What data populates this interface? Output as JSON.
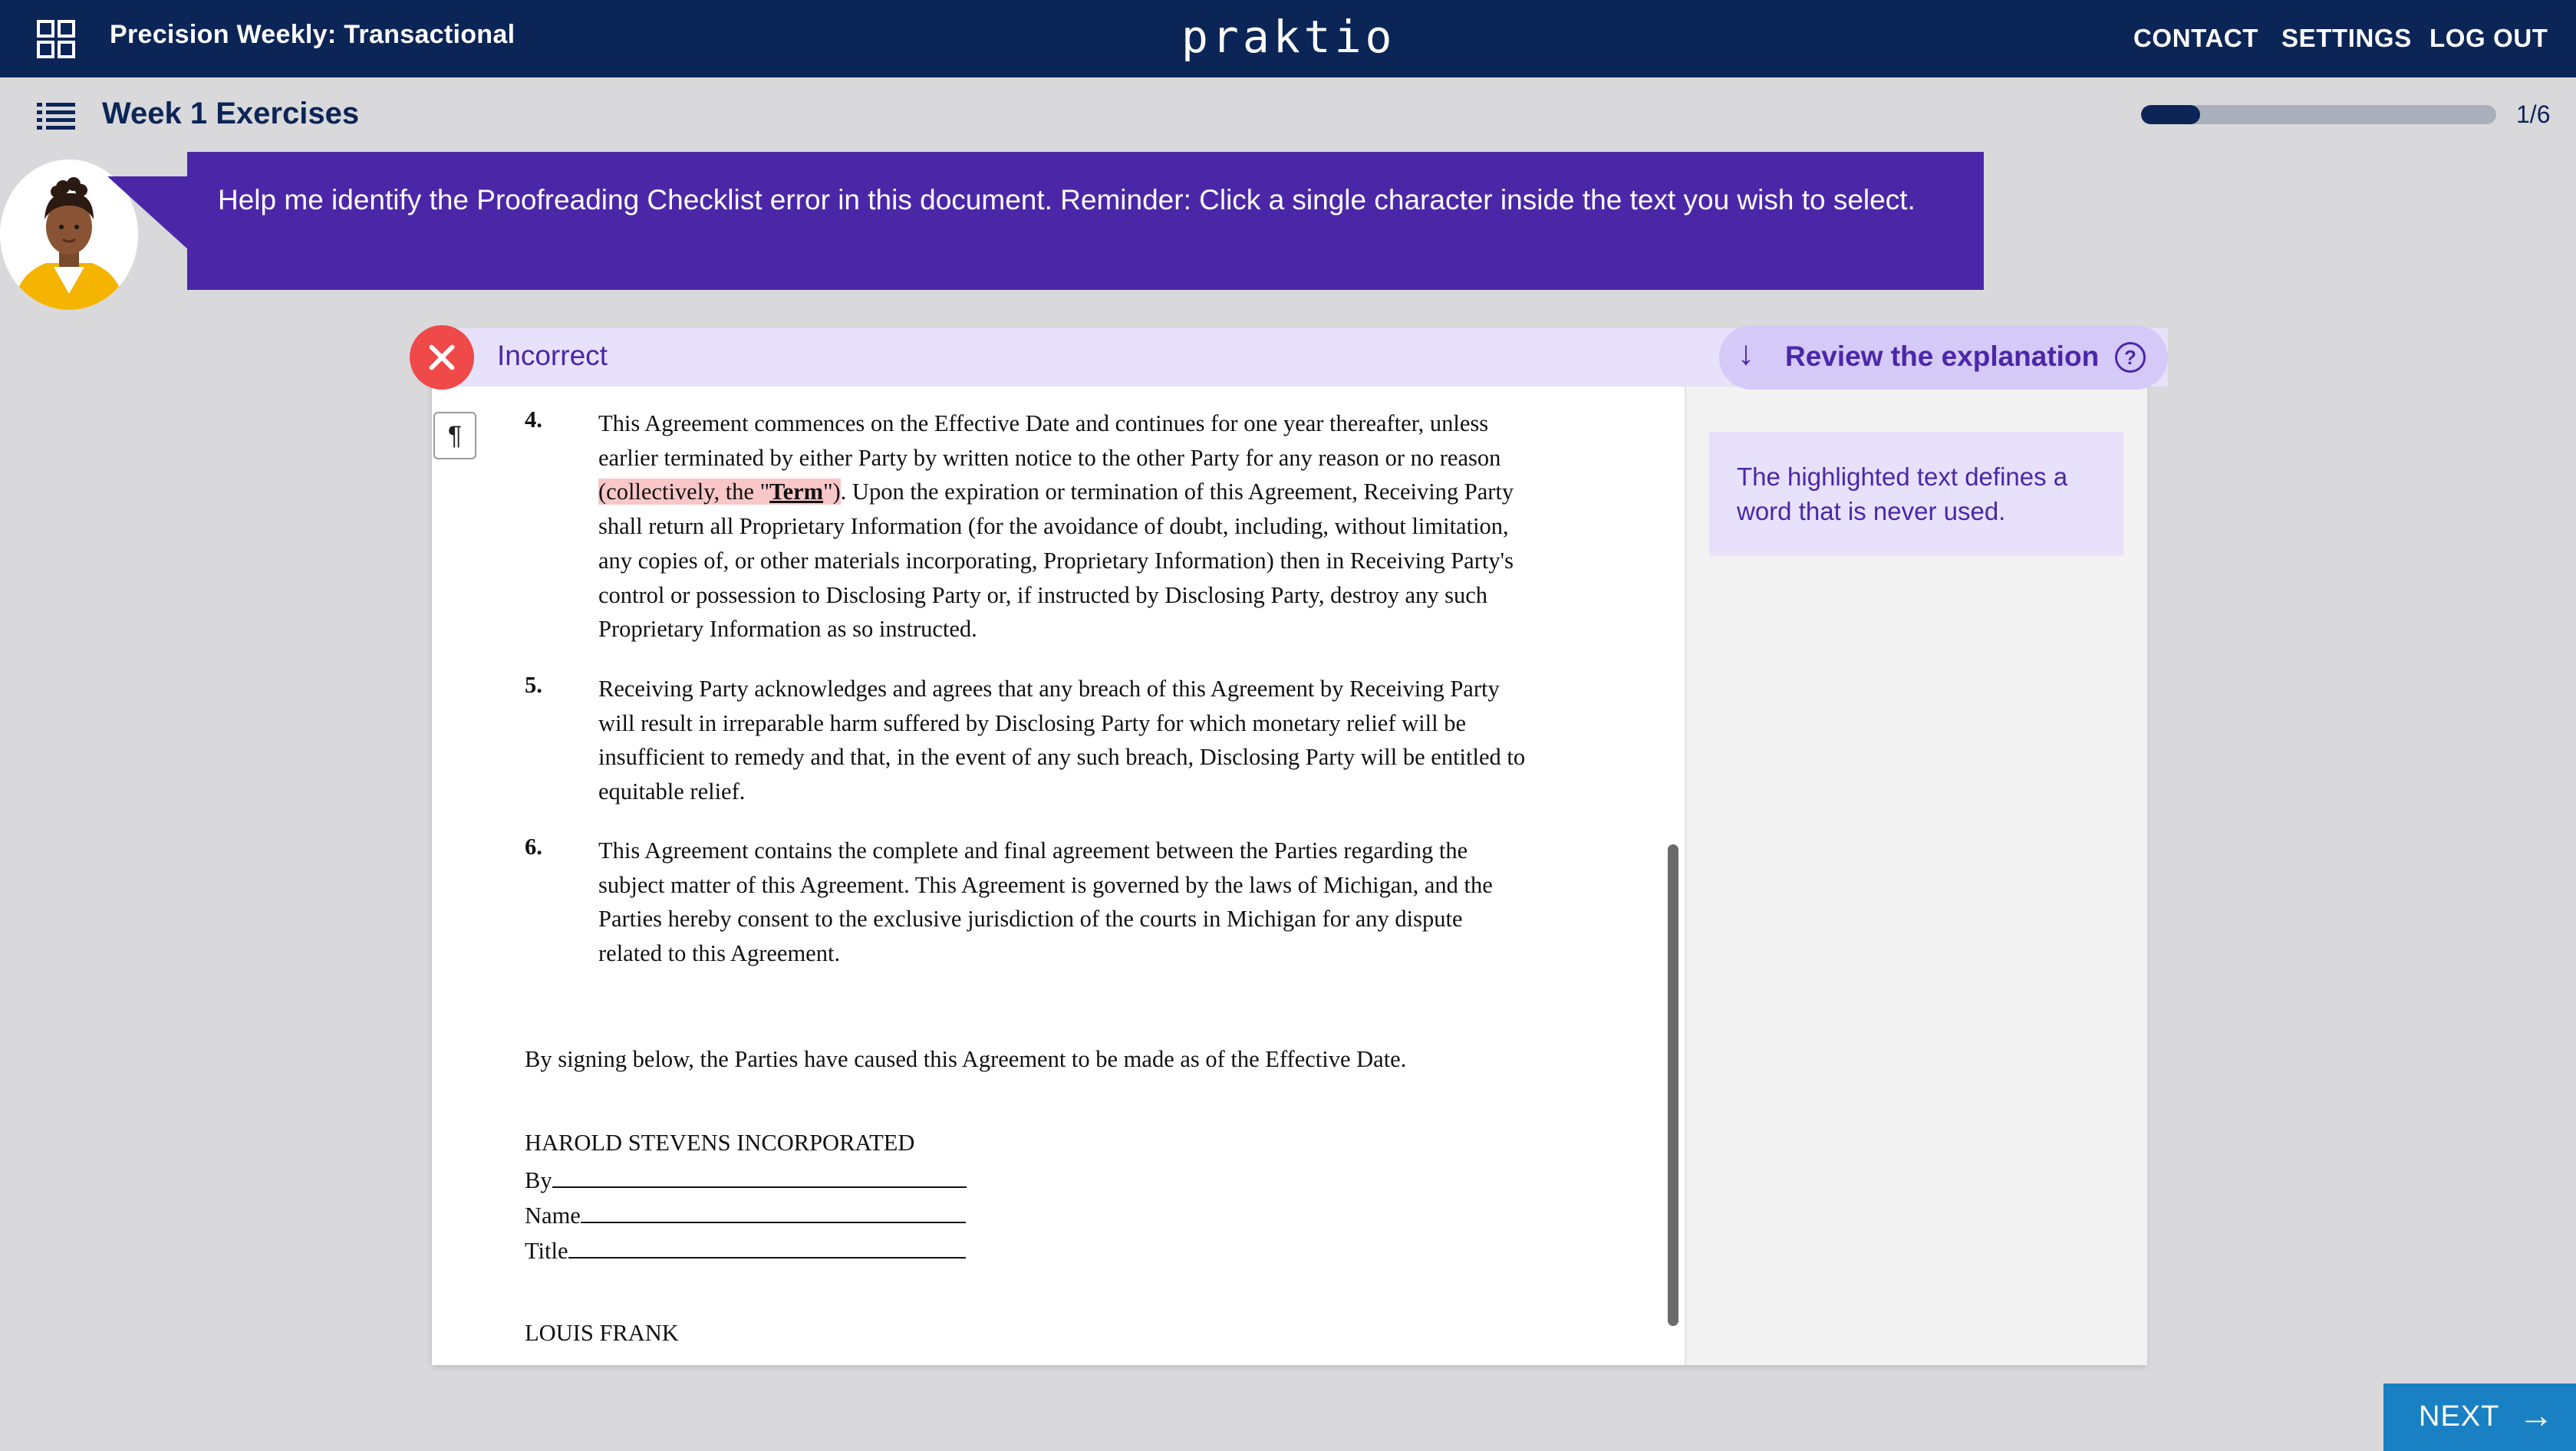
{
  "app": {
    "title": "Precision Weekly: Transactional",
    "brand": "praktio"
  },
  "nav": {
    "contact": "CONTACT",
    "settings": "SETTINGS",
    "logout": "LOG OUT"
  },
  "lesson": {
    "title": "Week 1 Exercises",
    "progress_text": "1/6",
    "progress_fraction": 0.167
  },
  "prompt": {
    "text": "Help me identify the Proofreading Checklist error in this document. Reminder: Click a single character inside the text you wish to select."
  },
  "result": {
    "status": "Incorrect",
    "review_label": "Review the explanation",
    "arrow_icon": "↓",
    "help_icon": "?",
    "explanation": "The highlighted text defines a word that is never used."
  },
  "document": {
    "paragraph_mark": "¶",
    "clauses": [
      {
        "num": "4.",
        "lines": [
          "This Agreement commences on the Effective Date and continues for one year thereafter, unless",
          "earlier terminated by either Party by written notice to the other Party for any reason or no reason"
        ],
        "hl_before": "(collectively, the \"",
        "hl_term": "Term",
        "hl_after": "\")",
        "line3_rest": ". Upon the expiration or termination of this Agreement, Receiving Party",
        "lines_after": [
          "shall return all Proprietary Information (for the avoidance of doubt, including, without limitation,",
          "any copies of, or other materials incorporating, Proprietary Information) then in Receiving Party's",
          "control or possession to Disclosing Party or, if instructed by Disclosing Party, destroy any such",
          "Proprietary Information as so instructed."
        ]
      },
      {
        "num": "5.",
        "lines": [
          "Receiving Party acknowledges and agrees that any breach of this Agreement by Receiving Party",
          "will result in irreparable harm suffered by Disclosing Party for which monetary relief will be",
          "insufficient to remedy and that, in the event of any such breach, Disclosing Party will be entitled to",
          "equitable relief."
        ]
      },
      {
        "num": "6.",
        "lines": [
          "This Agreement contains the complete and final agreement between the Parties regarding the",
          "subject matter of this Agreement. This Agreement is governed by the laws of Michigan, and the",
          "Parties hereby consent to the exclusive jurisdiction of the courts in Michigan for any dispute",
          "related to this Agreement."
        ]
      }
    ],
    "closing": "By signing below, the Parties have caused this Agreement to be made as of the Effective Date.",
    "party1": "HAROLD STEVENS INCORPORATED",
    "sig_by": "By",
    "sig_name": "Name",
    "sig_title": "Title",
    "party2": "LOUIS FRANK"
  },
  "footer": {
    "next_label": "NEXT",
    "next_icon": "→"
  },
  "colors": {
    "navy": "#0c2557",
    "purple": "#4b27a8",
    "lavender": "#e7e1fb",
    "error_red": "#f0494a",
    "highlight": "#f9c7c8",
    "next_blue": "#1a80c4"
  }
}
